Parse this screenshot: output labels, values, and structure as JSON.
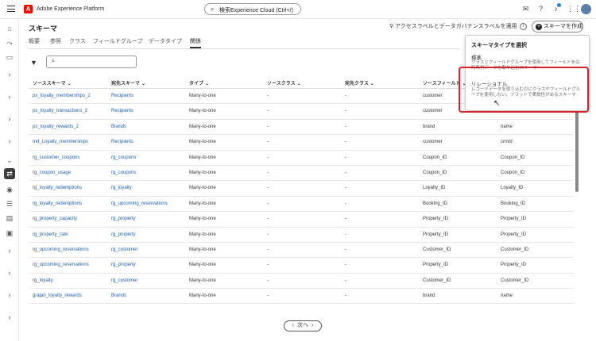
{
  "app": {
    "title": "Adobe Experience Platform"
  },
  "search": {
    "label": "検索Experience Cloud (Ctrl+/)"
  },
  "page": {
    "title": "スキーマ"
  },
  "header": {
    "apply_label": "アクセスラベルとデータガバナンスラベルを適用",
    "create_label": "スキーマを作成"
  },
  "tabs": [
    {
      "label": "概要"
    },
    {
      "label": "参照"
    },
    {
      "label": "クラス"
    },
    {
      "label": "フィールドグループ"
    },
    {
      "label": "データタイプ"
    },
    {
      "label": "関係"
    }
  ],
  "columns": [
    "ソーススキーマ",
    "宛先スキーマ",
    "タイプ",
    "ソースクラス",
    "宛先クラス",
    "ソースフィールド",
    ""
  ],
  "rows": [
    [
      "ps_loyalty_memberships_2",
      "Recipients",
      "Many-to-one",
      "-",
      "-",
      "customer",
      ""
    ],
    [
      "ps_loyalty_transactions_2",
      "Recipients",
      "Many-to-one",
      "-",
      "-",
      "customer",
      "crmid"
    ],
    [
      "ps_loyalty_rewards_2",
      "Brands",
      "Many-to-one",
      "-",
      "-",
      "brand",
      "name"
    ],
    [
      "md_Loyalty_memberships",
      "Recipients",
      "Many-to-one",
      "-",
      "-",
      "customer",
      "crmid"
    ],
    [
      "rg_customer_coupons",
      "rg_coupons",
      "Many-to-one",
      "-",
      "-",
      "Coupon_ID",
      "Coupon_ID"
    ],
    [
      "rg_coupon_usage",
      "rg_coupons",
      "Many-to-one",
      "-",
      "-",
      "Coupon_ID",
      "Coupon_ID"
    ],
    [
      "rg_loyalty_redemptions",
      "rg_loyalty",
      "Many-to-one",
      "-",
      "-",
      "Loyalty_ID",
      "Loyalty_ID"
    ],
    [
      "rg_loyalty_redemptions",
      "rg_upcoming_reservations",
      "Many-to-one",
      "-",
      "-",
      "Booking_ID",
      "Booking_ID"
    ],
    [
      "rg_property_capacity",
      "rg_property",
      "Many-to-one",
      "-",
      "-",
      "Property_ID",
      "Property_ID"
    ],
    [
      "rg_property_rate",
      "rg_property",
      "Many-to-one",
      "-",
      "-",
      "Property_ID",
      "Property_ID"
    ],
    [
      "rg_upcoming_reservations",
      "rg_customer",
      "Many-to-one",
      "-",
      "-",
      "Customer_ID",
      "Customer_ID"
    ],
    [
      "rg_upcoming_reservations",
      "rg_property",
      "Many-to-one",
      "-",
      "-",
      "Property_ID",
      "Property_ID"
    ],
    [
      "rg_loyalty",
      "rg_customer",
      "Many-to-one",
      "-",
      "-",
      "Customer_ID",
      "Customer_ID"
    ],
    [
      "grajan_loyalty_rewards",
      "Brands",
      "Many-to-one",
      "-",
      "-",
      "brand",
      "name"
    ]
  ],
  "pager": {
    "next_label": "次へ"
  },
  "popover": {
    "title": "スキーマタイプを選択",
    "standard_title": "標準",
    "standard_desc": "クラスとフィールドグループを使用してフィールドをは時系列データを取り込むスキーマ",
    "relational_title": "リレーショナル",
    "relational_desc": "レコードデータを取り込むのにクラスやフィールドグループを使用しない、フラットで柔軟性があるスキーマ"
  }
}
